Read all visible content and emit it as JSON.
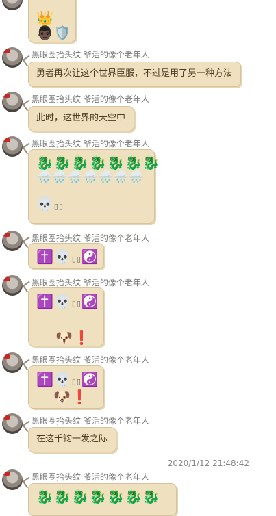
{
  "user": {
    "sender": "黑眼圈抬头纹 爷活的像个老年人"
  },
  "messages": [
    {
      "text": "勇者再次让这个世界臣服，不过是用了另一种方法"
    },
    {
      "text": "此时，这世界的天空中"
    },
    {
      "text": "在这千钧一发之际"
    }
  ],
  "emojis": {
    "crown": "👑",
    "face": "👨🏿",
    "shield": "🛡️",
    "dragon": "🐉🐉🐉🐉🐉🐉🐉",
    "cloud": "🌧️🌧️🌧️🌧️🌧️🌧️🌧️",
    "skull": "💀",
    "cross_skull_yinyang": "✝️💀",
    "yin_yang": "☯️",
    "dog_exclaim": "🐶❗",
    "boxes": "▯▯"
  },
  "timestamp": "2020/1/12 21:48:42"
}
